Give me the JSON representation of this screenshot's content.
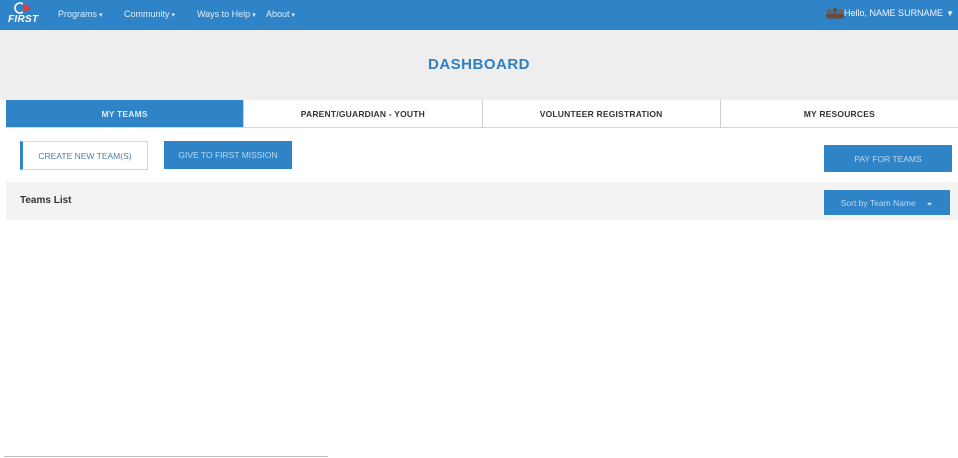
{
  "header": {
    "logo_text": "FIRST",
    "nav": [
      {
        "label": "Programs"
      },
      {
        "label": "Community"
      },
      {
        "label": "Ways to Help"
      },
      {
        "label": "About"
      }
    ],
    "user_label": "Hello, NAME SURNAME"
  },
  "page": {
    "title": "DASHBOARD"
  },
  "tabs": [
    {
      "label": "MY TEAMS",
      "active": true
    },
    {
      "label": "PARENT/GUARDIAN - YOUTH",
      "active": false
    },
    {
      "label": "VOLUNTEER REGISTRATION",
      "active": false
    },
    {
      "label": "MY RESOURCES",
      "active": false
    }
  ],
  "actions": {
    "create_label": "CREATE NEW TEAM(S)",
    "give_label": "GIVE TO FIRST MISSION",
    "pay_label": "PAY FOR TEAMS"
  },
  "teams_list": {
    "title": "Teams List",
    "sort_label": "Sort by Team Name"
  },
  "colors": {
    "brand_blue": "#2f83c7",
    "title_blue": "#2e7fc4"
  }
}
